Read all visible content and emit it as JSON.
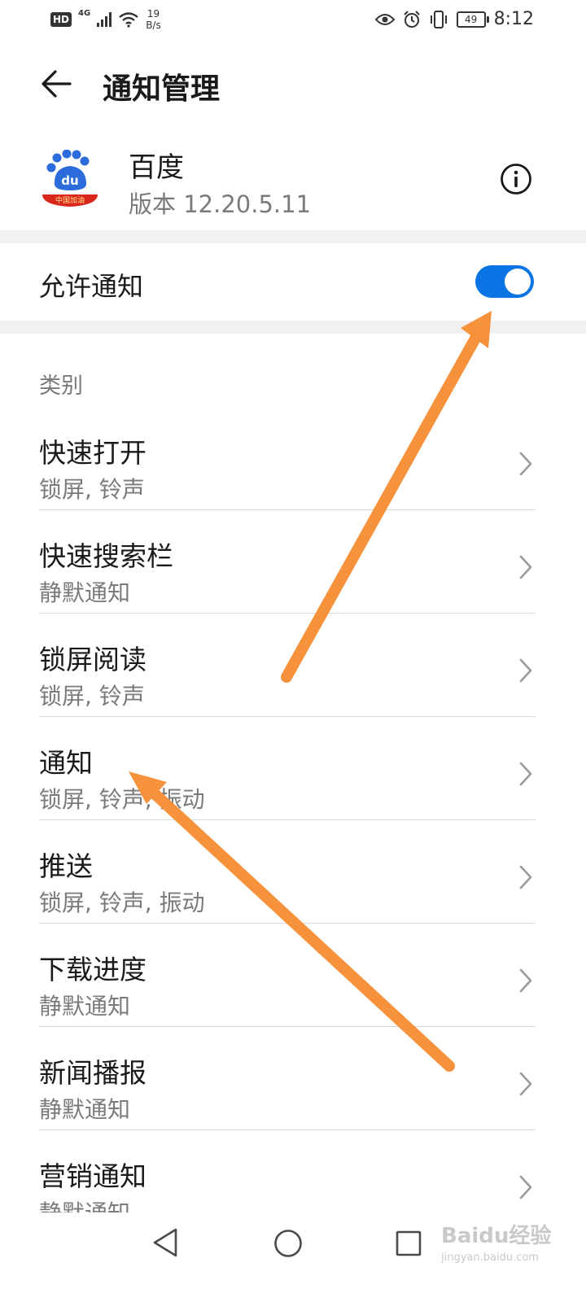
{
  "status_bar": {
    "hd": "HD",
    "network": "4G",
    "speed_value": "19",
    "speed_unit": "B/s",
    "battery": "49",
    "time": "8:12"
  },
  "header": {
    "title": "通知管理"
  },
  "app": {
    "name": "百度",
    "version": "版本 12.20.5.11",
    "icon_text": "du",
    "icon_banner": "中国加油"
  },
  "allow_notifications": {
    "label": "允许通知",
    "enabled": true
  },
  "section_label": "类别",
  "categories": [
    {
      "title": "快速打开",
      "subtitle": "锁屏, 铃声"
    },
    {
      "title": "快速搜索栏",
      "subtitle": "静默通知"
    },
    {
      "title": "锁屏阅读",
      "subtitle": "锁屏, 铃声"
    },
    {
      "title": "通知",
      "subtitle": "锁屏, 铃声, 振动"
    },
    {
      "title": "推送",
      "subtitle": "锁屏, 铃声, 振动"
    },
    {
      "title": "下载进度",
      "subtitle": "静默通知"
    },
    {
      "title": "新闻播报",
      "subtitle": "静默通知"
    },
    {
      "title": "营销通知",
      "subtitle": "静默通知"
    }
  ],
  "watermark": {
    "main": "Baidu经验",
    "url": "jingyan.baidu.com"
  },
  "colors": {
    "accent": "#0a74e4",
    "annotation_arrow": "#f7923c"
  }
}
